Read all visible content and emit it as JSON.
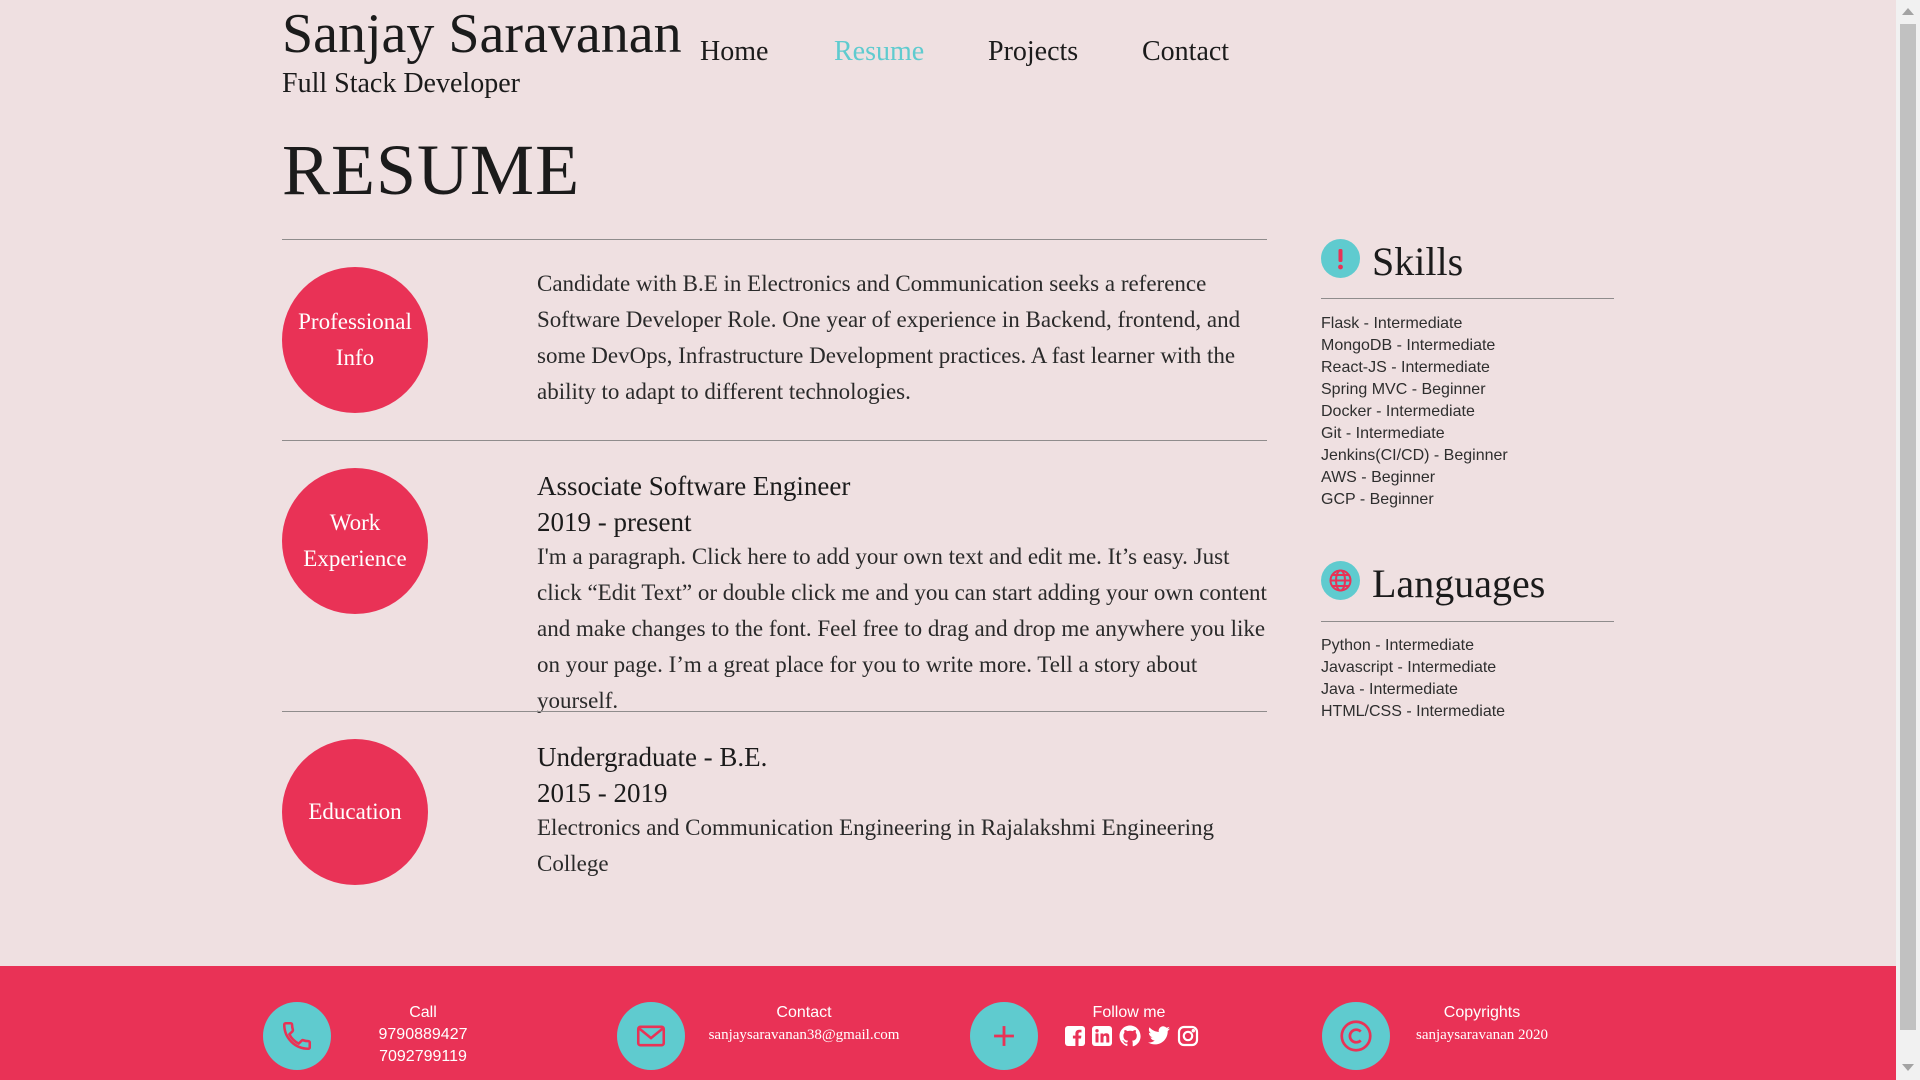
{
  "header": {
    "name": "Sanjay Saravanan",
    "tagline": "Full Stack Developer",
    "nav": [
      "Home",
      "Resume",
      "Projects",
      "Contact"
    ],
    "active_nav": "Resume"
  },
  "page_title": "RESUME",
  "sections": [
    {
      "label_line1": "Professional",
      "label_line2": "Info",
      "text": "Candidate with B.E in Electronics and Communication seeks a reference Software Developer Role. One year of experience in Backend, frontend, and some DevOps, Infrastructure Development practices. A fast learner with the ability to adapt to different technologies."
    },
    {
      "label_line1": "Work",
      "label_line2": "Experience",
      "title": "Associate Software Engineer",
      "period": "2019 - present",
      "text": "I'm a paragraph. Click here to add your own text and edit me. It’s easy. Just click “Edit Text” or double click me and you can start adding your own content and make changes to the font. Feel free to drag and drop me anywhere you like on your page. I’m a great place for you to write more. Tell a story about yourself."
    },
    {
      "label_line1": "Education",
      "title": "Undergraduate - B.E.",
      "period": "2015 - 2019",
      "text": "Electronics and Communication Engineering in Rajalakshmi Engineering College"
    }
  ],
  "skills": {
    "heading": "Skills",
    "icon": "exclamation-icon",
    "items": [
      "Flask - Intermediate",
      "MongoDB - Intermediate",
      "React-JS - Intermediate",
      "Spring MVC - Beginner",
      "Docker - Intermediate",
      "Git - Intermediate",
      "Jenkins(CI/CD) - Beginner",
      "AWS - Beginner",
      "GCP - Beginner"
    ]
  },
  "languages": {
    "heading": "Languages",
    "icon": "globe-icon",
    "items": [
      "Python - Intermediate",
      "Javascript - Intermediate",
      "Java - Intermediate",
      "HTML/CSS - Intermediate"
    ]
  },
  "footer": {
    "call": {
      "label": "Call",
      "phone1": "9790889427",
      "phone2": "7092799119",
      "icon": "phone-icon"
    },
    "contact": {
      "label": "Contact",
      "email": "sanjaysaravanan38@gmail.com",
      "icon": "mail-icon"
    },
    "follow": {
      "label": "Follow me",
      "icon": "plus-icon",
      "networks": [
        "facebook-icon",
        "linkedin-icon",
        "github-icon",
        "twitter-icon",
        "instagram-icon"
      ]
    },
    "copyright": {
      "label": "Copyrights",
      "text": "sanjaysaravanan 2020",
      "icon": "copyright-icon"
    }
  },
  "colors": {
    "background": "#efe0e1",
    "accent_red": "#e93256",
    "accent_teal": "#5fcbcf",
    "text": "#1b1b1b"
  }
}
